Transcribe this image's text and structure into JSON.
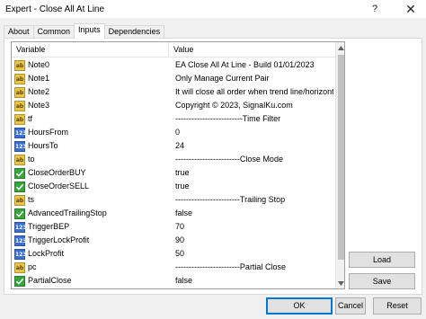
{
  "window": {
    "title": "Expert - Close All At Line",
    "help_label": "?",
    "close_label": "✕"
  },
  "tabs": [
    {
      "label": "About",
      "active": false
    },
    {
      "label": "Common",
      "active": false
    },
    {
      "label": "Inputs",
      "active": true
    },
    {
      "label": "Dependencies",
      "active": false
    }
  ],
  "table": {
    "headers": {
      "variable": "Variable",
      "value": "Value"
    },
    "rows": [
      {
        "type": "string",
        "icon": "ab",
        "variable": "Note0",
        "value": "EA Close All At Line - Build 01/01/2023"
      },
      {
        "type": "string",
        "icon": "ab",
        "variable": "Note1",
        "value": "Only Manage Current Pair"
      },
      {
        "type": "string",
        "icon": "ab",
        "variable": "Note2",
        "value": "It will close all order when trend line/horizontal li..."
      },
      {
        "type": "string",
        "icon": "ab",
        "variable": "Note3",
        "value": "Copyright © 2023, SignalKu.com"
      },
      {
        "type": "string",
        "icon": "ab",
        "variable": "tf",
        "value": "-------------------------Time Filter"
      },
      {
        "type": "int",
        "icon": "123",
        "variable": "HoursFrom",
        "value": "0"
      },
      {
        "type": "int",
        "icon": "123",
        "variable": "HoursTo",
        "value": "24"
      },
      {
        "type": "string",
        "icon": "ab",
        "variable": "to",
        "value": "------------------------Close Mode"
      },
      {
        "type": "bool",
        "icon": "check",
        "variable": "CloseOrderBUY",
        "value": "true"
      },
      {
        "type": "bool",
        "icon": "check",
        "variable": "CloseOrderSELL",
        "value": "true"
      },
      {
        "type": "string",
        "icon": "ab",
        "variable": "ts",
        "value": "------------------------Trailing Stop"
      },
      {
        "type": "bool",
        "icon": "check",
        "variable": "AdvancedTrailingStop",
        "value": "false"
      },
      {
        "type": "int",
        "icon": "123",
        "variable": "TriggerBEP",
        "value": "70"
      },
      {
        "type": "int",
        "icon": "123",
        "variable": "TriggerLockProfit",
        "value": "90"
      },
      {
        "type": "int",
        "icon": "123",
        "variable": "LockProfit",
        "value": "50"
      },
      {
        "type": "string",
        "icon": "ab",
        "variable": "pc",
        "value": "------------------------Partial Close"
      },
      {
        "type": "bool",
        "icon": "check",
        "variable": "PartialClose",
        "value": "false"
      }
    ]
  },
  "buttons": {
    "load": "Load",
    "save": "Save",
    "ok": "OK",
    "cancel": "Cancel",
    "reset": "Reset"
  }
}
